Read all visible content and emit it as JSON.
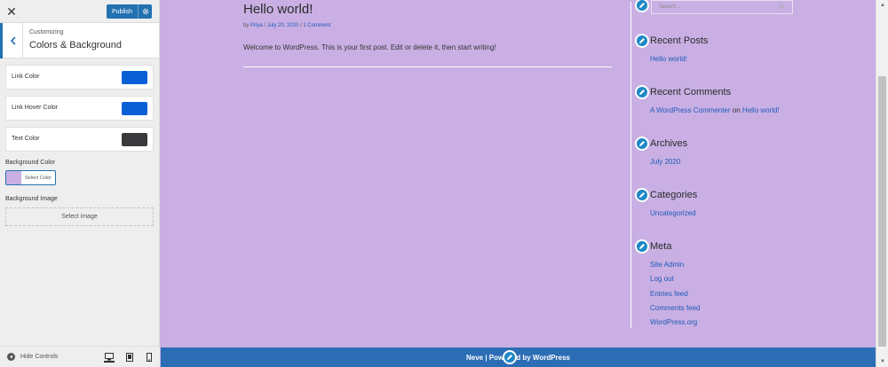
{
  "sidebar": {
    "close_glyph": "✕",
    "publish_label": "Publish",
    "customizing_label": "Customizing",
    "section_title": "Colors & Background",
    "link_color": {
      "label": "Link Color",
      "value": "#0a5fd6"
    },
    "link_hover_color": {
      "label": "Link Hover Color",
      "value": "#0a5fd6"
    },
    "text_color": {
      "label": "Text Color",
      "value": "#3a3a3c"
    },
    "background_color_label": "Background Color",
    "background_color_value": "#c9afe4",
    "select_color_label": "Select Color",
    "background_image_label": "Background Image",
    "select_image_label": "Select image",
    "hide_controls_label": "Hide Controls"
  },
  "preview": {
    "post": {
      "title": "Hello world!",
      "meta_by": "by",
      "meta_author": "Priya",
      "meta_sep": " / ",
      "meta_date": "July 20, 2020",
      "meta_comments": "1 Comment",
      "body": "Welcome to WordPress. This is your first post. Edit or delete it, then start writing!"
    },
    "search_placeholder": "Search ...",
    "widgets": {
      "recent_posts": {
        "title": "Recent Posts",
        "items": [
          "Hello world!"
        ]
      },
      "recent_comments": {
        "title": "Recent Comments",
        "commenter": "A WordPress Commenter",
        "on": "on",
        "post": "Hello world!"
      },
      "archives": {
        "title": "Archives",
        "items": [
          "July 2020"
        ]
      },
      "categories": {
        "title": "Categories",
        "items": [
          "Uncategorized"
        ]
      },
      "meta": {
        "title": "Meta",
        "items": [
          "Site Admin",
          "Log out",
          "Entries feed",
          "Comments feed",
          "WordPress.org"
        ]
      }
    },
    "footer": {
      "left": "Neve | Pow",
      "right": "d by WordPress"
    }
  },
  "colors": {
    "accent": "#2271b1",
    "preview_bg": "#c9afe4",
    "footer_bg": "#2c6db5",
    "link": "#1e5bb6"
  }
}
